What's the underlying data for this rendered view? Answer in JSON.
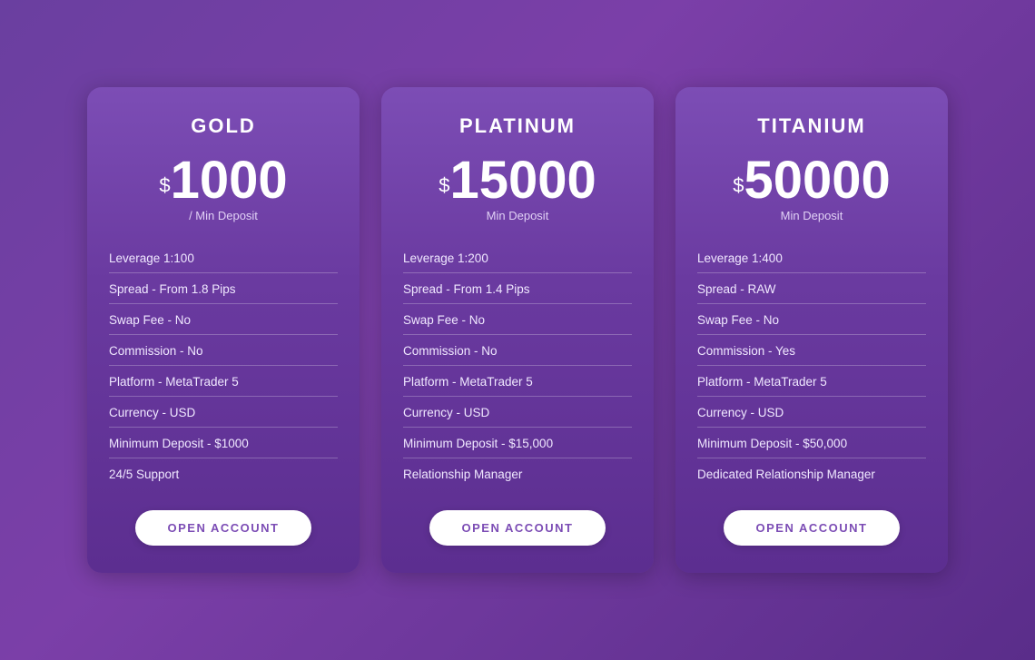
{
  "cards": [
    {
      "id": "gold",
      "title": "GOLD",
      "price_symbol": "$",
      "price_amount": "1000",
      "price_label": "/ Min Deposit",
      "features": [
        "Leverage 1:100",
        "Spread - From 1.8 Pips",
        "Swap Fee - No",
        "Commission - No",
        "Platform - MetaTrader 5",
        "Currency - USD",
        "Minimum Deposit - $1000",
        "24/5 Support"
      ],
      "button_label": "OPEN ACCOUNT"
    },
    {
      "id": "platinum",
      "title": "PLATINUM",
      "price_symbol": "$",
      "price_amount": "15000",
      "price_label": "Min Deposit",
      "features": [
        "Leverage 1:200",
        "Spread - From 1.4 Pips",
        "Swap Fee - No",
        "Commission - No",
        "Platform - MetaTrader 5",
        "Currency - USD",
        "Minimum Deposit - $15,000",
        "Relationship Manager"
      ],
      "button_label": "OPEN ACCOUNT"
    },
    {
      "id": "titanium",
      "title": "TITANIUM",
      "price_symbol": "$",
      "price_amount": "50000",
      "price_label": "Min Deposit",
      "features": [
        "Leverage 1:400",
        "Spread - RAW",
        "Swap Fee - No",
        "Commission - Yes",
        "Platform - MetaTrader 5",
        "Currency - USD",
        "Minimum Deposit - $50,000",
        "Dedicated Relationship Manager"
      ],
      "button_label": "OPEN ACCOUNT"
    }
  ]
}
